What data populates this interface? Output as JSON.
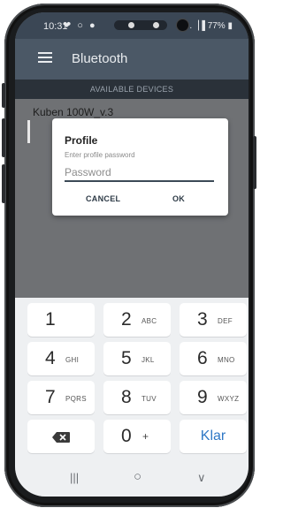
{
  "status_bar": {
    "time": "10:31",
    "icons": "❤ ○ ●",
    "battery": "77%",
    "signal": ".▕▐"
  },
  "app_bar": {
    "title": "Bluetooth",
    "menu_icon": "hamburger-menu-icon"
  },
  "section_header": "AVAILABLE DEVICES",
  "devices": [
    {
      "name": "Kuben 100W_v.3"
    }
  ],
  "dialog": {
    "title": "Profile",
    "message": "Enter profile password",
    "input_placeholder": "Password",
    "input_value": "",
    "cancel_label": "CANCEL",
    "ok_label": "OK"
  },
  "keypad": {
    "rows": [
      [
        {
          "num": "1",
          "letters": ""
        },
        {
          "num": "2",
          "letters": "ABC"
        },
        {
          "num": "3",
          "letters": "DEF"
        }
      ],
      [
        {
          "num": "4",
          "letters": "GHI"
        },
        {
          "num": "5",
          "letters": "JKL"
        },
        {
          "num": "6",
          "letters": "MNO"
        }
      ],
      [
        {
          "num": "7",
          "letters": "PQRS"
        },
        {
          "num": "8",
          "letters": "TUV"
        },
        {
          "num": "9",
          "letters": "WXYZ"
        }
      ]
    ],
    "zero": "0",
    "plus": "+",
    "done_label": "Klar"
  },
  "nav_bar": {
    "recents": "|||",
    "home": "○",
    "back": "∨"
  },
  "colors": {
    "app_bar": "#4b5866",
    "status_bar": "#3b4755",
    "accent": "#2f78c6",
    "keyboard_bg": "#eef0f2"
  }
}
